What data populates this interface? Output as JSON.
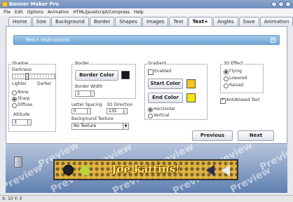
{
  "window": {
    "title": "Banner Maker Pro"
  },
  "menu": [
    "File",
    "Edit",
    "Options",
    "Animation",
    "HTML/JavaScript/Compress",
    "Help"
  ],
  "tabs": [
    {
      "label": "Home"
    },
    {
      "label": "Size"
    },
    {
      "label": "Background"
    },
    {
      "label": "Border"
    },
    {
      "label": "Shapes"
    },
    {
      "label": "Images"
    },
    {
      "label": "Text"
    },
    {
      "label": "Text+",
      "active": true
    },
    {
      "label": "Angles"
    },
    {
      "label": "Save"
    },
    {
      "label": "Animation"
    }
  ],
  "instructions": {
    "title": "Text+ Instructions"
  },
  "shadow": {
    "title": "Shadow",
    "darkness_label": "Darkness",
    "lighter_label": "Lighter",
    "darker_label": "Darker",
    "options": [
      {
        "label": "None"
      },
      {
        "label": "Sharp",
        "selected": true
      },
      {
        "label": "Diffuse"
      }
    ],
    "altitude_label": "Altitude",
    "altitude_value": "3"
  },
  "border": {
    "title": "Border",
    "button_label": "Border Color",
    "color": "#1a1a1a",
    "width_label": "Border Width",
    "width_value": "2"
  },
  "spacing": {
    "letter_spacing_label": "Letter Spacing",
    "letter_spacing_value": "0",
    "direction_label": "3D Direction",
    "direction_value": "135"
  },
  "texture": {
    "label": "Background Texture",
    "value": "No Texture"
  },
  "gradient": {
    "title": "Gradient",
    "enabled_label": "Enabled",
    "enabled": false,
    "start_label": "Start Color",
    "start_color": "#f2c31a",
    "end_label": "End Color",
    "end_color": "#f2e40e",
    "orientation": [
      {
        "label": "Horizontal",
        "selected": true
      },
      {
        "label": "Vertical"
      }
    ]
  },
  "effect3d": {
    "title": "3D Effect",
    "options": [
      {
        "label": "Flying",
        "selected": true
      },
      {
        "label": "Lowered"
      },
      {
        "label": "Raised"
      }
    ]
  },
  "antialiased": {
    "label": "AntiAliased Text",
    "checked": true
  },
  "nav": {
    "previous_label": "Previous",
    "next_label": "Next"
  },
  "preview": {
    "watermark": "Preview",
    "banner_text": "Joe kattins!",
    "banner_color": "#e3b43f"
  },
  "status": {
    "text": "X: 10  Y: 3"
  }
}
